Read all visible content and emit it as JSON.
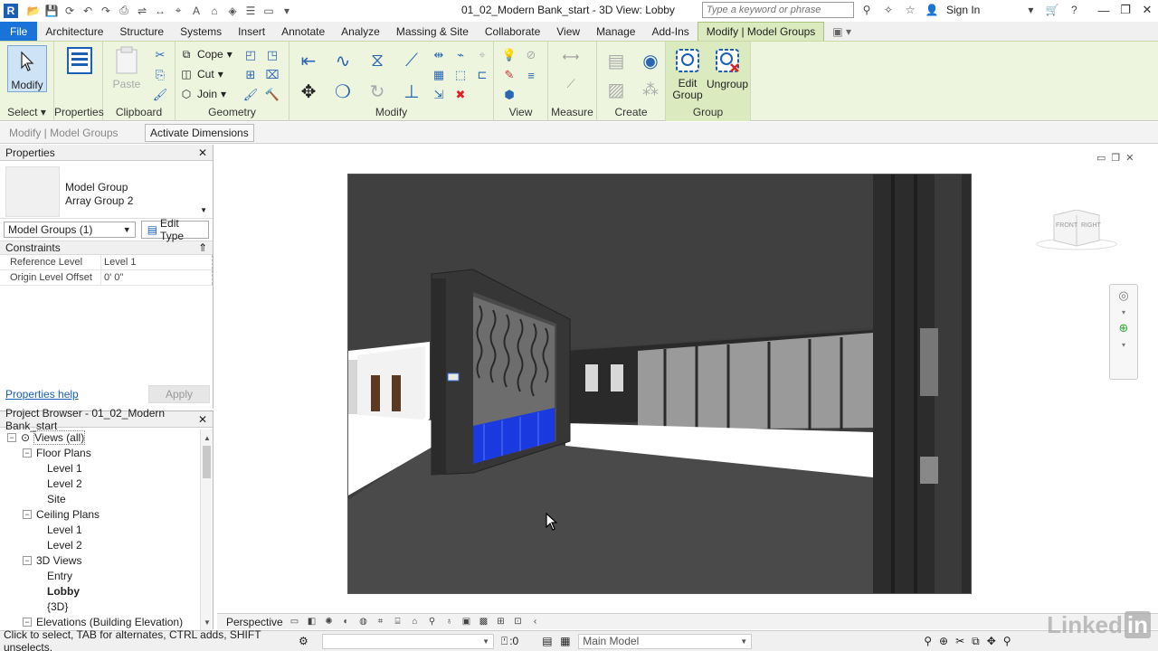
{
  "title": {
    "document": "01_02_Modern Bank_start - 3D View: Lobby",
    "search_placeholder": "Type a keyword or phrase",
    "sign_in": "Sign In",
    "logo": "R"
  },
  "tabs": [
    {
      "label": "File"
    },
    {
      "label": "Architecture"
    },
    {
      "label": "Structure"
    },
    {
      "label": "Systems"
    },
    {
      "label": "Insert"
    },
    {
      "label": "Annotate"
    },
    {
      "label": "Analyze"
    },
    {
      "label": "Massing & Site"
    },
    {
      "label": "Collaborate"
    },
    {
      "label": "View"
    },
    {
      "label": "Manage"
    },
    {
      "label": "Add-Ins"
    },
    {
      "label": "Modify | Model Groups"
    }
  ],
  "ribbon": {
    "modify": "Modify",
    "properties": "Properties",
    "select": "Select",
    "paste": "Paste",
    "clipboard": "Clipboard",
    "cope": "Cope",
    "cut": "Cut",
    "join": "Join",
    "geometry": "Geometry",
    "modify_panel": "Modify",
    "view_panel": "View",
    "measure_panel": "Measure",
    "create_panel": "Create",
    "edit_group": "Edit",
    "edit_group2": "Group",
    "ungroup": "Ungroup",
    "group_panel": "Group"
  },
  "optbar": {
    "context": "Modify | Model Groups",
    "activate_dimensions": "Activate Dimensions"
  },
  "properties": {
    "header": "Properties",
    "type_line1": "Model Group",
    "type_line2": "Array Group 2",
    "instance_selector": "Model Groups (1)",
    "edit_type": "Edit Type",
    "group_constraints": "Constraints",
    "rows": [
      {
        "key": "Reference Level",
        "value": "Level 1"
      },
      {
        "key": "Origin Level Offset",
        "value": "0'  0\""
      }
    ],
    "help": "Properties help",
    "apply": "Apply"
  },
  "browser": {
    "header": "Project Browser - 01_02_Modern Bank_start",
    "items": [
      {
        "label": "Views (all)",
        "indent": 0,
        "toggle": "−",
        "bold": false
      },
      {
        "label": "Floor Plans",
        "indent": 1,
        "toggle": "−",
        "bold": false
      },
      {
        "label": "Level 1",
        "indent": 2,
        "toggle": "",
        "bold": false
      },
      {
        "label": "Level 2",
        "indent": 2,
        "toggle": "",
        "bold": false
      },
      {
        "label": "Site",
        "indent": 2,
        "toggle": "",
        "bold": false
      },
      {
        "label": "Ceiling Plans",
        "indent": 1,
        "toggle": "−",
        "bold": false
      },
      {
        "label": "Level 1",
        "indent": 2,
        "toggle": "",
        "bold": false
      },
      {
        "label": "Level 2",
        "indent": 2,
        "toggle": "",
        "bold": false
      },
      {
        "label": "3D Views",
        "indent": 1,
        "toggle": "−",
        "bold": false
      },
      {
        "label": "Entry",
        "indent": 2,
        "toggle": "",
        "bold": false
      },
      {
        "label": "Lobby",
        "indent": 2,
        "toggle": "",
        "bold": true
      },
      {
        "label": "{3D}",
        "indent": 2,
        "toggle": "",
        "bold": false
      },
      {
        "label": "Elevations (Building Elevation)",
        "indent": 1,
        "toggle": "−",
        "bold": false
      }
    ]
  },
  "viewcube": {
    "front": "FRONT",
    "right": "RIGHT"
  },
  "viewctl": {
    "label": "Perspective"
  },
  "status": {
    "message": "Click to select, TAB for alternates, CTRL adds, SHIFT unselects.",
    "count": ":0",
    "model": "Main Model"
  },
  "watermark": {
    "text": "Linked",
    "in": "in"
  },
  "colors": {
    "accent": "#1a73d9",
    "contextual_tab": "#dbeabf",
    "ribbon_bg": "#eef5df",
    "panel_blue": "#1a5fb4"
  }
}
